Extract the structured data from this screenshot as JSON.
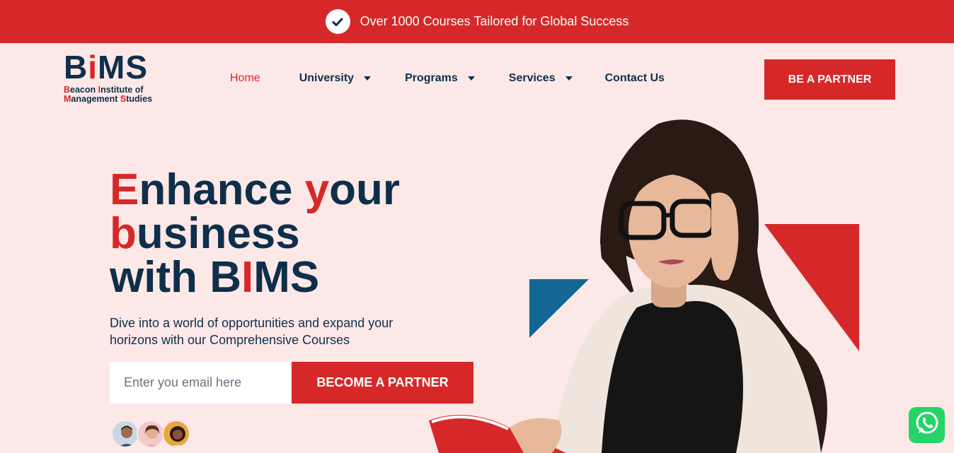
{
  "announcement": {
    "icon": "check-icon",
    "text": "Over 1000 Courses Tailored for Global Success"
  },
  "logo": {
    "mark_b": "B",
    "mark_i": "i",
    "mark_ms": "MS",
    "line1_r": "B",
    "line1_rest": "eacon ",
    "line1_r2": "I",
    "line1_rest2": "nstitute of",
    "line2_r": "M",
    "line2_rest": "anagement ",
    "line2_r2": "S",
    "line2_rest2": "tudies"
  },
  "nav": {
    "items": [
      {
        "label": "Home",
        "active": true,
        "dropdown": false
      },
      {
        "label": "University",
        "active": false,
        "dropdown": true
      },
      {
        "label": "Programs",
        "active": false,
        "dropdown": true
      },
      {
        "label": "Services",
        "active": false,
        "dropdown": true
      },
      {
        "label": "Contact Us",
        "active": false,
        "dropdown": false
      }
    ],
    "cta": "BE A PARTNER"
  },
  "hero": {
    "t_E": "E",
    "t_nhance": "nhance ",
    "t_y": "y",
    "t_our": "our",
    "t_b": "b",
    "t_usiness": "usiness",
    "t_with": "with B",
    "t_I": "I",
    "t_MS": "MS",
    "description": "Dive into a world of opportunities and expand your horizons with our Comprehensive Courses",
    "email_placeholder": "Enter you email here",
    "cta": "BECOME A PARTNER"
  },
  "colors": {
    "primary_red": "#d62828",
    "navy": "#0e2f4a",
    "background": "#fde8e8",
    "accent_blue": "#126795",
    "whatsapp": "#25d366"
  },
  "floating": {
    "whatsapp_icon": "whatsapp-icon"
  }
}
